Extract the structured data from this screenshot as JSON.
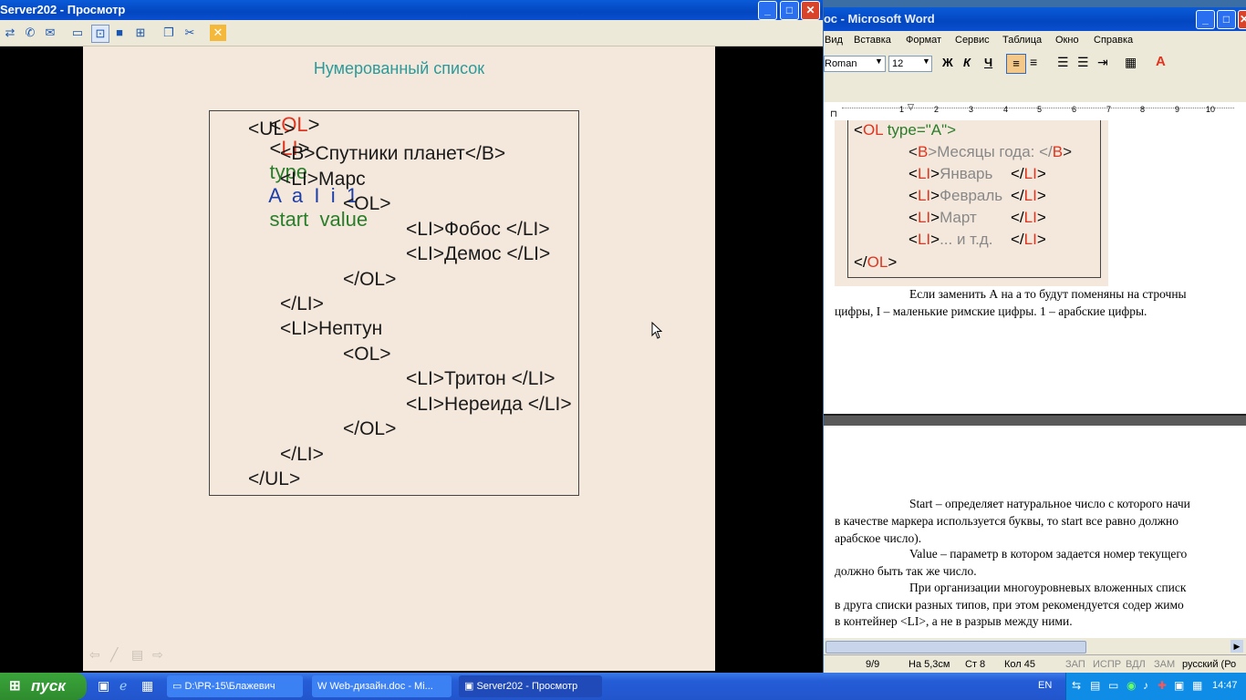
{
  "viewer": {
    "title": "Server202 - Просмотр",
    "slide": {
      "heading": "Нумерованный список",
      "syntax": {
        "ol_open": "<",
        "ol": "OL",
        "ol_close": ">",
        "li_open": "<",
        "li": "LI",
        "li_close": ">",
        "attrs1": "type",
        "attrs2": "A  a  I  i  1",
        "attrs3": "start  value"
      },
      "code": [
        "<UL>",
        "<B>Спутники планет</B>",
        "<LI>Марс",
        "<OL>",
        "<LI>Фобос </LI>",
        "<LI>Демос </LI>",
        "</OL>",
        "</LI>",
        "<LI>Нептун",
        "<OL>",
        "<LI>Тритон </LI>",
        "<LI>Нереида </LI>",
        "</OL>",
        "</LI>",
        "</UL>"
      ]
    }
  },
  "word": {
    "title": "ос - Microsoft Word",
    "menu": [
      "Вид",
      "Вставка",
      "Формат",
      "Сервис",
      "Таблица",
      "Окно",
      "Справка"
    ],
    "font_name": "Roman",
    "font_size": "12",
    "format_buttons": [
      "Ж",
      "К",
      "Ч"
    ],
    "ruler_marks": [
      "1",
      "2",
      "3",
      "4",
      "5",
      "6",
      "7",
      "8",
      "9",
      "10"
    ],
    "figure": {
      "ol_line_a": "<",
      "ol_tag": "OL",
      "ol_attr": " type=\"A\">",
      "b_open": "<",
      "b_tag": "B",
      "b_text": ">Месяцы года: </",
      "b_close_tag": "B",
      "items": [
        "Январь",
        "Февраль",
        "Март",
        "... и т.д."
      ],
      "li_tag": "LI",
      "close_ol": "OL"
    },
    "para1_line1": "Если заменить А на а то будут поменяны на строчны",
    "para1_line2": "цифры, I – маленькие римские цифры. 1 – арабские цифры.",
    "para2_line1": "Start – определяет натуральное число с которого начи",
    "para2_line2": "в качестве маркера используется буквы, то start все равно должно",
    "para2_line3": "арабское число).",
    "para3_line1": "Value – параметр в котором задается номер текущего",
    "para3_line2": "должно быть так же число.",
    "para4_line1": "При организации многоуровневых вложенных списк",
    "para4_line2": "в друга списки разных типов, при этом рекомендуется содер жимо",
    "para4_line3": "в контейнер <LI>, а не в разрыв между ними.",
    "status": {
      "page": "9/9",
      "at": "На 5,3см",
      "line": "Ст 8",
      "col": "Кол 45",
      "rec": "ЗАП",
      "trk": "ИСПР",
      "ext": "ВДЛ",
      "ovr": "ЗАМ",
      "lang": "русский (Ро"
    }
  },
  "taskbar": {
    "start": "пуск",
    "tasks": [
      "D:\\PR-15\\Блажевич",
      "Web-дизайн.doc - Mi...",
      "Server202 - Просмотр"
    ],
    "lang": "EN",
    "clock": "14:47"
  },
  "colors": {
    "red": "#e0341e",
    "green": "#2a7d2a",
    "blue": "#1e3fa8",
    "heading": "#2a9a9a"
  }
}
